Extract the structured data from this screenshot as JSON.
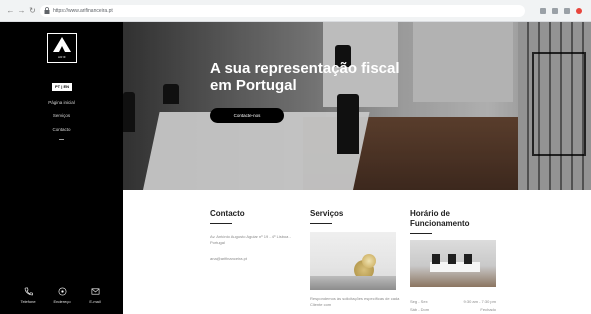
{
  "browser": {
    "url": "https://www.arifinanceira.pt",
    "back_icon": "arrow-left-icon",
    "forward_icon": "arrow-right-icon",
    "reload_icon": "reload-icon"
  },
  "sidebar": {
    "logo_text": "ARIF",
    "language": "PT | EN",
    "menu": [
      {
        "label": "Página inicial"
      },
      {
        "label": "Serviços"
      },
      {
        "label": "Contacto"
      }
    ],
    "bottom_links": [
      {
        "label": "Telefone",
        "icon": "phone-icon"
      },
      {
        "label": "Endereço",
        "icon": "location-pin-icon"
      },
      {
        "label": "E-mail",
        "icon": "mail-icon"
      }
    ]
  },
  "hero": {
    "title": "A sua representação fiscal em Portugal",
    "button_label": "Contacte-nos"
  },
  "contact": {
    "title": "Contacto",
    "address": "Av. António Augusto Aguiar nº 19 - 4º Lisboa - Portugal",
    "email": "ana@arifinanceira.pt"
  },
  "services": {
    "title": "Serviços",
    "description": "Respondemos às solicitações específicas de cada Cliente com"
  },
  "hours": {
    "title": "Horário de Funcionamento",
    "rows": [
      {
        "day": "Seg - Sex",
        "time": "9:30 am - 7:30 pm"
      },
      {
        "day": "Sáb - Dom",
        "time": "Fechado"
      }
    ]
  },
  "colors": {
    "sidebar_bg": "#000000",
    "hero_button_bg": "#000000",
    "accent_red": "#e8453c"
  }
}
